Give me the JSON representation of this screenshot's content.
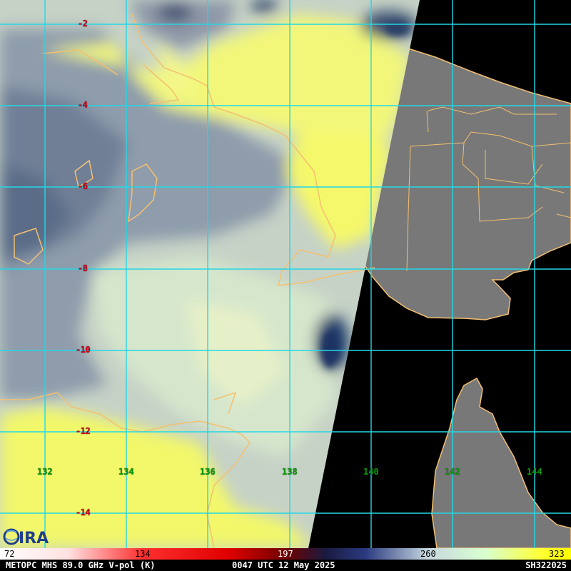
{
  "latitudes": [
    {
      "label": "-2"
    },
    {
      "label": "-4"
    },
    {
      "label": "-6"
    },
    {
      "label": "-8"
    },
    {
      "label": "-10"
    },
    {
      "label": "-12"
    },
    {
      "label": "-14"
    }
  ],
  "longitudes": [
    {
      "label": "132"
    },
    {
      "label": "134"
    },
    {
      "label": "136"
    },
    {
      "label": "138"
    },
    {
      "label": "140"
    },
    {
      "label": "142"
    },
    {
      "label": "144"
    }
  ],
  "colorbar": {
    "ticks": [
      "72",
      "134",
      "197",
      "260",
      "323"
    ],
    "range": [
      72,
      323
    ],
    "unit": "K"
  },
  "footer": {
    "product": "METOPC MHS 89.0 GHz V-pol (K)",
    "time": "0047 UTC 12 May 2025",
    "storm_id": "SH322025"
  },
  "logo_text": "CIRA",
  "colors": {
    "grid": "#22d8e6",
    "coast": "#f4c070",
    "land": "#7a7a7a",
    "nodata": "#000000",
    "warm": "#ffff55",
    "cold": "#1a2a5a"
  }
}
